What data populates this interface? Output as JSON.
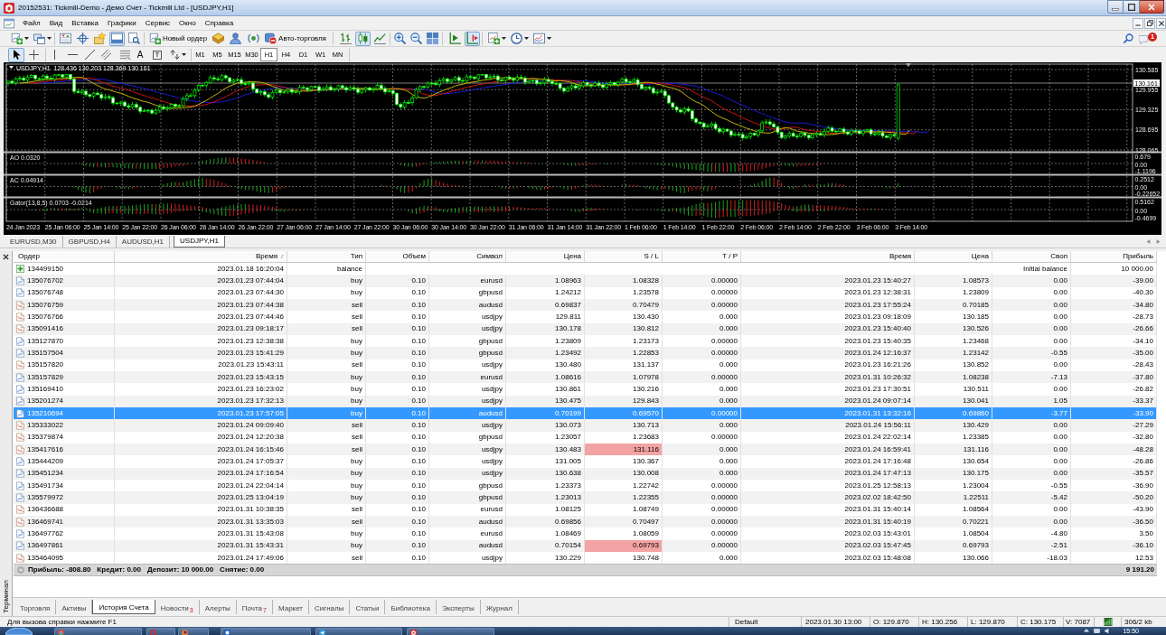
{
  "window": {
    "title": "20152531: Tickmill-Demo - Демо Счет - Tickmill Ltd - [USDJPY,H1]"
  },
  "menu": [
    "Файл",
    "Вид",
    "Вставка",
    "Графики",
    "Сервис",
    "Окно",
    "Справка"
  ],
  "toolbar": [
    {
      "pressed": false
    },
    {
      "pressed": false
    },
    {
      "pressed": false
    },
    {
      "pressed": false
    },
    {
      "pressed": false
    },
    {
      "pressed": true
    },
    {
      "pressed": false
    },
    {
      "label": "Новый ордер",
      "pressed": false
    },
    {
      "pressed": false
    },
    {
      "pressed": false
    },
    {
      "pressed": false
    },
    {
      "label": "Авто-торговля",
      "pressed": false
    },
    {
      "pressed": false
    },
    {
      "pressed": true
    },
    {
      "pressed": false
    },
    {
      "pressed": false
    },
    {
      "pressed": false
    },
    {
      "pressed": false
    },
    {
      "pressed": false
    },
    {
      "pressed": true
    },
    {
      "pressed": false
    },
    {
      "pressed": false
    },
    {
      "pressed": false
    }
  ],
  "notifications": {
    "count": "1"
  },
  "drawing_tools": [
    {
      "pressed": true
    },
    {
      "pressed": false
    },
    {
      "pressed": false
    },
    {
      "pressed": false
    },
    {
      "pressed": false
    },
    {
      "pressed": false
    },
    {
      "pressed": false
    },
    {
      "glyph": "A",
      "pressed": false
    },
    {
      "glyph": "T",
      "pressed": false
    },
    {
      "pressed": false
    }
  ],
  "periods": [
    {
      "label": "M1",
      "selected": false
    },
    {
      "label": "M5",
      "selected": false
    },
    {
      "label": "M15",
      "selected": false
    },
    {
      "label": "M30",
      "selected": false
    },
    {
      "label": "H1",
      "selected": true
    },
    {
      "label": "H4",
      "selected": false
    },
    {
      "label": "D1",
      "selected": false
    },
    {
      "label": "W1",
      "selected": false
    },
    {
      "label": "MN",
      "selected": false
    }
  ],
  "chart": {
    "info": {
      "symbol": "USDJPY,H1",
      "values": [
        "128.436",
        "130.203",
        "128.369",
        "130.161"
      ]
    },
    "price_labels": [
      "130.585",
      "129.955",
      "129.325",
      "128.695",
      "128.065"
    ],
    "current_price": "130.161",
    "indicators": [
      {
        "kind": "ao",
        "label": "AO 0.0320",
        "axis_labels": [
          "0.679",
          "0.00",
          "-1.1196"
        ]
      },
      {
        "kind": "ac",
        "label": "AC 0.04914",
        "axis_labels": [
          "0.2512",
          "0.00",
          "-0.22652"
        ]
      },
      {
        "kind": "gator",
        "label": "Gator(13,8,5) 0.0703 -0.0214",
        "axis_labels": [
          "0.5162",
          "0.00",
          "-0.4699"
        ]
      }
    ],
    "time_labels": [
      "24 Jan 2023",
      "25 Jan 06:00",
      "25 Jan 14:00",
      "25 Jan 22:00",
      "26 Jan 06:00",
      "26 Jan 14:00",
      "26 Jan 22:00",
      "27 Jan 06:00",
      "27 Jan 14:00",
      "27 Jan 22:00",
      "30 Jan 06:00",
      "30 Jan 14:00",
      "30 Jan 22:00",
      "31 Jan 06:00",
      "31 Jan 14:00",
      "31 Jan 22:00",
      "1 Feb 06:00",
      "1 Feb 14:00",
      "1 Feb 22:00",
      "2 Feb 06:00",
      "2 Feb 14:00",
      "2 Feb 22:00",
      "3 Feb 06:00",
      "3 Feb 14:00"
    ]
  },
  "chart_tabs": [
    {
      "label": "EURUSD,M30",
      "selected": false
    },
    {
      "label": "GBPUSD,H4",
      "selected": false
    },
    {
      "label": "AUDUSD,H1",
      "selected": false
    },
    {
      "label": "USDJPY,H1",
      "selected": true
    }
  ],
  "terminal": {
    "title": "Терминал",
    "columns": [
      "Ордер",
      "Время",
      "Тип",
      "Объем",
      "Символ",
      "Цена",
      "S / L",
      "T / P",
      "Время",
      "Цена",
      "Своп",
      "Прибыль"
    ],
    "rows": [
      {
        "kind": "balance",
        "order": "134499150",
        "open_time": "2023.01.18 16:20:04",
        "type": "balance",
        "comment": "Initial balance",
        "profit": "10 000.00",
        "selected": false
      },
      {
        "kind": "buy",
        "order": "135076702",
        "open_time": "2023.01.23 07:44:04",
        "type": "buy",
        "volume": "0.10",
        "symbol": "eurusd",
        "open_price": "1.08963",
        "sl": "1.08328",
        "tp": "0.00000",
        "close_time": "2023.01.23 15:40:27",
        "close_price": "1.08573",
        "swap": "0.00",
        "profit": "-39.00",
        "selected": false,
        "sl_hit": false
      },
      {
        "kind": "buy",
        "order": "135076748",
        "open_time": "2023.01.23 07:44:30",
        "type": "buy",
        "volume": "0.10",
        "symbol": "gbpusd",
        "open_price": "1.24212",
        "sl": "1.23578",
        "tp": "0.00000",
        "close_time": "2023.01.23 12:38:31",
        "close_price": "1.23809",
        "swap": "0.00",
        "profit": "-40.30",
        "selected": false,
        "sl_hit": false
      },
      {
        "kind": "sell",
        "order": "135076759",
        "open_time": "2023.01.23 07:44:38",
        "type": "sell",
        "volume": "0.10",
        "symbol": "audusd",
        "open_price": "0.69837",
        "sl": "0.70479",
        "tp": "0.00000",
        "close_time": "2023.01.23 17:55:24",
        "close_price": "0.70185",
        "swap": "0.00",
        "profit": "-34.80",
        "selected": false,
        "sl_hit": false
      },
      {
        "kind": "sell",
        "order": "135076766",
        "open_time": "2023.01.23 07:44:46",
        "type": "sell",
        "volume": "0.10",
        "symbol": "usdjpy",
        "open_price": "129.811",
        "sl": "130.430",
        "tp": "0.000",
        "close_time": "2023.01.23 09:18:09",
        "close_price": "130.185",
        "swap": "0.00",
        "profit": "-28.73",
        "selected": false,
        "sl_hit": false
      },
      {
        "kind": "sell",
        "order": "135091416",
        "open_time": "2023.01.23 09:18:17",
        "type": "sell",
        "volume": "0.10",
        "symbol": "usdjpy",
        "open_price": "130.178",
        "sl": "130.812",
        "tp": "0.000",
        "close_time": "2023.01.23 15:40:40",
        "close_price": "130.526",
        "swap": "0.00",
        "profit": "-26.66",
        "selected": false,
        "sl_hit": false
      },
      {
        "kind": "buy",
        "order": "135127870",
        "open_time": "2023.01.23 12:38:38",
        "type": "buy",
        "volume": "0.10",
        "symbol": "gbpusd",
        "open_price": "1.23809",
        "sl": "1.23173",
        "tp": "0.00000",
        "close_time": "2023.01.23 15:40:35",
        "close_price": "1.23468",
        "swap": "0.00",
        "profit": "-34.10",
        "selected": false,
        "sl_hit": false
      },
      {
        "kind": "buy",
        "order": "135157504",
        "open_time": "2023.01.23 15:41:29",
        "type": "buy",
        "volume": "0.10",
        "symbol": "gbpusd",
        "open_price": "1.23492",
        "sl": "1.22853",
        "tp": "0.00000",
        "close_time": "2023.01.24 12:16:37",
        "close_price": "1.23142",
        "swap": "-0.55",
        "profit": "-35.00",
        "selected": false,
        "sl_hit": false
      },
      {
        "kind": "sell",
        "order": "135157820",
        "open_time": "2023.01.23 15:43:11",
        "type": "sell",
        "volume": "0.10",
        "symbol": "usdjpy",
        "open_price": "130.480",
        "sl": "131.137",
        "tp": "0.000",
        "close_time": "2023.01.23 16:21:26",
        "close_price": "130.852",
        "swap": "0.00",
        "profit": "-28.43",
        "selected": false,
        "sl_hit": false
      },
      {
        "kind": "buy",
        "order": "135157829",
        "open_time": "2023.01.23 15:43:15",
        "type": "buy",
        "volume": "0.10",
        "symbol": "eurusd",
        "open_price": "1.08616",
        "sl": "1.07978",
        "tp": "0.00000",
        "close_time": "2023.01.31 10:26:32",
        "close_price": "1.08238",
        "swap": "-7.13",
        "profit": "-37.80",
        "selected": false,
        "sl_hit": false
      },
      {
        "kind": "buy",
        "order": "135169410",
        "open_time": "2023.01.23 16:23:02",
        "type": "buy",
        "volume": "0.10",
        "symbol": "usdjpy",
        "open_price": "130.861",
        "sl": "130.216",
        "tp": "0.000",
        "close_time": "2023.01.23 17:30:51",
        "close_price": "130.511",
        "swap": "0.00",
        "profit": "-26.82",
        "selected": false,
        "sl_hit": false
      },
      {
        "kind": "buy",
        "order": "135201274",
        "open_time": "2023.01.23 17:32:13",
        "type": "buy",
        "volume": "0.10",
        "symbol": "usdjpy",
        "open_price": "130.475",
        "sl": "129.843",
        "tp": "0.000",
        "close_time": "2023.01.24 09:07:14",
        "close_price": "130.041",
        "swap": "1.05",
        "profit": "-33.37",
        "selected": false,
        "sl_hit": false
      },
      {
        "kind": "buy",
        "order": "135210694",
        "open_time": "2023.01.23 17:57:05",
        "type": "buy",
        "volume": "0.10",
        "symbol": "audusd",
        "open_price": "0.70199",
        "sl": "0.69570",
        "tp": "0.00000",
        "close_time": "2023.01.31 13:32:16",
        "close_price": "0.69860",
        "swap": "-3.77",
        "profit": "-33.90",
        "selected": true,
        "sl_hit": false
      },
      {
        "kind": "sell",
        "order": "135333022",
        "open_time": "2023.01.24 09:09:40",
        "type": "sell",
        "volume": "0.10",
        "symbol": "usdjpy",
        "open_price": "130.073",
        "sl": "130.713",
        "tp": "0.000",
        "close_time": "2023.01.24 15:56:11",
        "close_price": "130.429",
        "swap": "0.00",
        "profit": "-27.29",
        "selected": false,
        "sl_hit": false
      },
      {
        "kind": "sell",
        "order": "135379874",
        "open_time": "2023.01.24 12:20:38",
        "type": "sell",
        "volume": "0.10",
        "symbol": "gbpusd",
        "open_price": "1.23057",
        "sl": "1.23683",
        "tp": "0.00000",
        "close_time": "2023.01.24 22:02:14",
        "close_price": "1.23385",
        "swap": "0.00",
        "profit": "-32.80",
        "selected": false,
        "sl_hit": false
      },
      {
        "kind": "sell",
        "order": "135417616",
        "open_time": "2023.01.24 16:15:46",
        "type": "sell",
        "volume": "0.10",
        "symbol": "usdjpy",
        "open_price": "130.483",
        "sl": "131.116",
        "tp": "0.000",
        "close_time": "2023.01.24 16:59:41",
        "close_price": "131.116",
        "swap": "0.00",
        "profit": "-48.28",
        "selected": false,
        "sl_hit": true
      },
      {
        "kind": "buy",
        "order": "135444209",
        "open_time": "2023.01.24 17:05:37",
        "type": "buy",
        "volume": "0.10",
        "symbol": "usdjpy",
        "open_price": "131.005",
        "sl": "130.367",
        "tp": "0.000",
        "close_time": "2023.01.24 17:16:48",
        "close_price": "130.654",
        "swap": "0.00",
        "profit": "-26.86",
        "selected": false,
        "sl_hit": false
      },
      {
        "kind": "buy",
        "order": "135451234",
        "open_time": "2023.01.24 17:16:54",
        "type": "buy",
        "volume": "0.10",
        "symbol": "usdjpy",
        "open_price": "130.638",
        "sl": "130.008",
        "tp": "0.000",
        "close_time": "2023.01.24 17:47:13",
        "close_price": "130.175",
        "swap": "0.00",
        "profit": "-35.57",
        "selected": false,
        "sl_hit": false
      },
      {
        "kind": "buy",
        "order": "135491734",
        "open_time": "2023.01.24 22:04:14",
        "type": "buy",
        "volume": "0.10",
        "symbol": "gbpusd",
        "open_price": "1.23373",
        "sl": "1.22742",
        "tp": "0.00000",
        "close_time": "2023.01.25 12:58:13",
        "close_price": "1.23004",
        "swap": "-0.55",
        "profit": "-36.90",
        "selected": false,
        "sl_hit": false
      },
      {
        "kind": "buy",
        "order": "135579972",
        "open_time": "2023.01.25 13:04:19",
        "type": "buy",
        "volume": "0.10",
        "symbol": "gbpusd",
        "open_price": "1.23013",
        "sl": "1.22355",
        "tp": "0.00000",
        "close_time": "2023.02.02 18:42:50",
        "close_price": "1.22511",
        "swap": "-5.42",
        "profit": "-50.20",
        "selected": false,
        "sl_hit": false
      },
      {
        "kind": "sell",
        "order": "136436688",
        "open_time": "2023.01.31 10:38:35",
        "type": "sell",
        "volume": "0.10",
        "symbol": "eurusd",
        "open_price": "1.08125",
        "sl": "1.08749",
        "tp": "0.00000",
        "close_time": "2023.01.31 15:40:14",
        "close_price": "1.08564",
        "swap": "0.00",
        "profit": "-43.90",
        "selected": false,
        "sl_hit": false
      },
      {
        "kind": "sell",
        "order": "136469741",
        "open_time": "2023.01.31 13:35:03",
        "type": "sell",
        "volume": "0.10",
        "symbol": "audusd",
        "open_price": "0.69856",
        "sl": "0.70497",
        "tp": "0.00000",
        "close_time": "2023.01.31 15:40:19",
        "close_price": "0.70221",
        "swap": "0.00",
        "profit": "-36.50",
        "selected": false,
        "sl_hit": false
      },
      {
        "kind": "buy",
        "order": "136497762",
        "open_time": "2023.01.31 15:43:08",
        "type": "buy",
        "volume": "0.10",
        "symbol": "eurusd",
        "open_price": "1.08469",
        "sl": "1.08059",
        "tp": "0.00000",
        "close_time": "2023.02.03 15:43:01",
        "close_price": "1.08504",
        "swap": "-4.80",
        "profit": "3.50",
        "selected": false,
        "sl_hit": false
      },
      {
        "kind": "buy",
        "order": "136497861",
        "open_time": "2023.01.31 15:43:31",
        "type": "buy",
        "volume": "0.10",
        "symbol": "audusd",
        "open_price": "0.70154",
        "sl": "0.69793",
        "tp": "0.00000",
        "close_time": "2023.02.03 15:47:45",
        "close_price": "0.69793",
        "swap": "-2.51",
        "profit": "-36.10",
        "selected": false,
        "sl_hit": true
      },
      {
        "kind": "sell",
        "order": "135464095",
        "open_time": "2023.01.24 17:49:06",
        "type": "sell",
        "volume": "0.10",
        "symbol": "usdjpy",
        "open_price": "130.229",
        "sl": "130.748",
        "tp": "0.000",
        "close_time": "2023.02.03 15:48:08",
        "close_price": "130.066",
        "swap": "-18.03",
        "profit": "12.53",
        "selected": false,
        "sl_hit": false
      }
    ],
    "summary": {
      "items": [
        "Прибыль: -808.80",
        "Кредит: 0.00",
        "Депозит: 10 000.00",
        "Снятие: 0.00"
      ],
      "total": "9 191.20"
    },
    "tabs": [
      {
        "label": "Торговля",
        "selected": false
      },
      {
        "label": "Активы",
        "selected": false
      },
      {
        "label": "История Счета",
        "selected": true
      },
      {
        "label": "Новости",
        "badge": "3",
        "selected": false
      },
      {
        "label": "Алерты",
        "selected": false
      },
      {
        "label": "Почта",
        "badge": "7",
        "selected": false
      },
      {
        "label": "Маркет",
        "selected": false
      },
      {
        "label": "Сигналы",
        "selected": false
      },
      {
        "label": "Статьи",
        "selected": false
      },
      {
        "label": "Библиотека",
        "selected": false
      },
      {
        "label": "Эксперты",
        "selected": false
      },
      {
        "label": "Журнал",
        "selected": false
      }
    ]
  },
  "status_bar": {
    "help": "Для вызова справки нажмите F1",
    "profile": "Default",
    "time": "2023.01.30 13:00",
    "open": "O: 129.870",
    "high": "H: 130.256",
    "low": "L: 129.870",
    "close": "C: 130.175",
    "volume": "V: 7087",
    "traffic": "306/2 kb"
  },
  "taskbar": {
    "clock": "15:50"
  }
}
